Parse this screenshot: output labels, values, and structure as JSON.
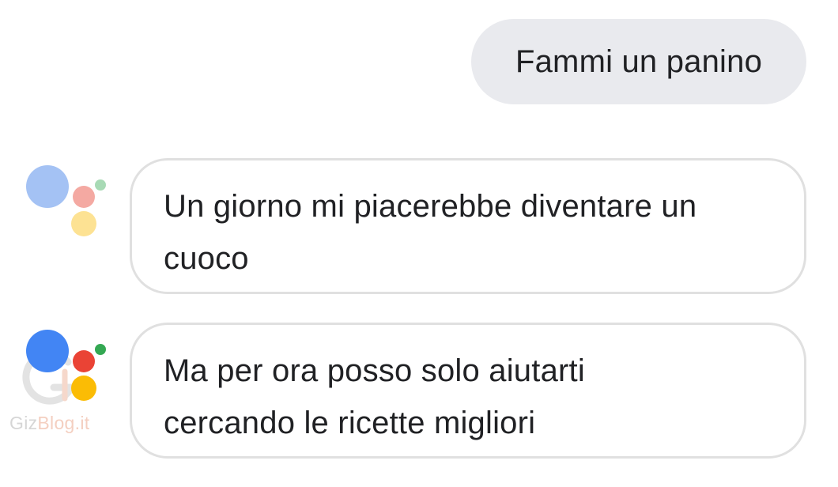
{
  "conversation": {
    "user_message": "Fammi un panino",
    "assistant_messages": [
      {
        "lines": [
          "Un giorno mi piacerebbe diventare un",
          "cuoco"
        ],
        "logo_state": "faded"
      },
      {
        "lines": [
          "Ma per ora posso solo aiutarti",
          "cercando le ricette migliori"
        ],
        "logo_state": "active"
      }
    ]
  },
  "assistant_logo": {
    "icon": "google-assistant-icon",
    "colors": {
      "blue": "#4285f4",
      "red": "#ea4335",
      "yellow": "#fbbc05",
      "green": "#34a853"
    },
    "faded_colors": {
      "blue": "#a4c2f4",
      "red": "#f4a9a2",
      "yellow": "#fde293",
      "green": "#a8dab5"
    }
  },
  "watermark": {
    "text_part1": "Giz",
    "text_part2": "Blog.it"
  }
}
